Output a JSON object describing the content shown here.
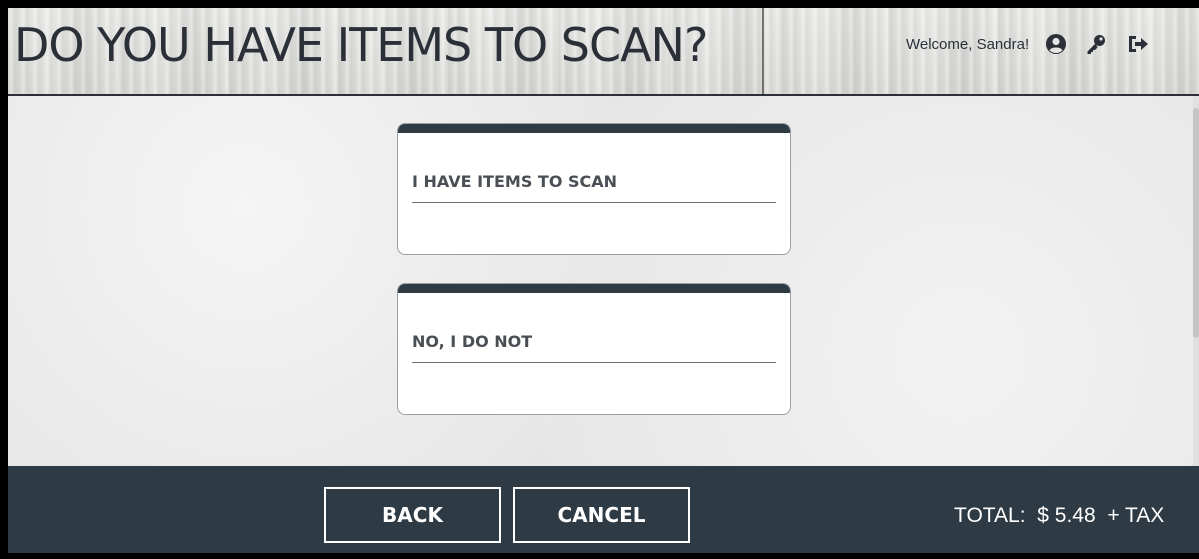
{
  "header": {
    "title": "DO YOU HAVE ITEMS TO SCAN?",
    "welcome_text": "Welcome, Sandra!",
    "icons": [
      "user-circle-icon",
      "key-icon",
      "sign-out-icon"
    ]
  },
  "options": [
    {
      "label": "I HAVE ITEMS TO SCAN"
    },
    {
      "label": "NO, I DO NOT"
    }
  ],
  "footer": {
    "back_label": "BACK",
    "cancel_label": "CANCEL",
    "total_label": "TOTAL:",
    "total_amount": "$ 5.48",
    "tax_suffix": "+ TAX"
  },
  "colors": {
    "header_text": "#2b3038",
    "footer_bg": "#2e3a44",
    "card_bar": "#2e3a44",
    "card_text": "#4a4f55"
  }
}
